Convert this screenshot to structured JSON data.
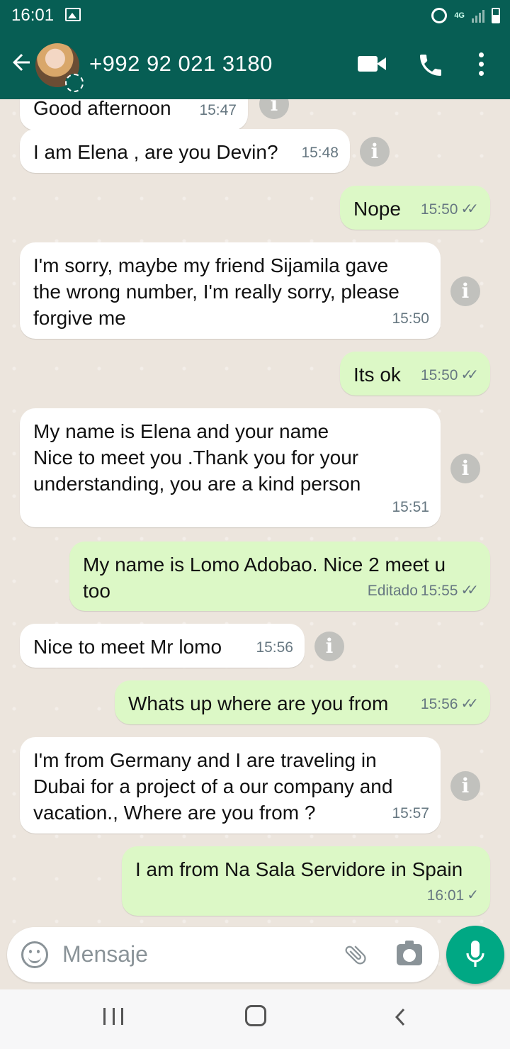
{
  "status_bar": {
    "time": "16:01",
    "network": "4G"
  },
  "header": {
    "contact_name": "+992 92 021 3180"
  },
  "messages": [
    {
      "dir": "in",
      "text": "Good afternoon",
      "time": "15:47",
      "info": true
    },
    {
      "dir": "in",
      "text": "I am Elena , are you Devin?",
      "time": "15:48",
      "info": true
    },
    {
      "dir": "out",
      "text": "Nope",
      "time": "15:50",
      "ticks": "✓✓"
    },
    {
      "dir": "in",
      "text": "I'm sorry, maybe my friend Sijamila gave\nthe wrong number, I'm really sorry, please\nforgive me",
      "time": "15:50",
      "info": true
    },
    {
      "dir": "out",
      "text": "Its ok",
      "time": "15:50",
      "ticks": "✓✓"
    },
    {
      "dir": "in",
      "text": "My name is Elena and your name\nNice to meet you .Thank you for your\nunderstanding, you are a kind person",
      "time": "15:51",
      "info": true
    },
    {
      "dir": "out",
      "text": "My name is Lomo Adobao. Nice 2 meet u\ntoo",
      "time": "15:55",
      "edited": "Editado",
      "ticks": "✓✓"
    },
    {
      "dir": "in",
      "text": "Nice to meet Mr lomo",
      "time": "15:56",
      "info": true
    },
    {
      "dir": "out",
      "text": "Whats up where are you from",
      "time": "15:56",
      "ticks": "✓✓"
    },
    {
      "dir": "in",
      "text": "I'm from Germany and I are traveling in\nDubai for a project of a our company and\nvacation., Where are you from ?",
      "time": "15:57",
      "info": true
    },
    {
      "dir": "out",
      "text": "I am from Na Sala Servidore in Spain",
      "time": "16:01",
      "ticks": "✓"
    }
  ],
  "input": {
    "placeholder": "Mensaje"
  },
  "icons": {
    "back": "arrow-left-icon",
    "video": "video-call-icon",
    "call": "phone-icon",
    "menu": "more-vert-icon",
    "emoji": "emoji-icon",
    "attach": "paperclip-icon",
    "camera": "camera-icon",
    "mic": "microphone-icon",
    "info": "info-icon"
  },
  "colors": {
    "header": "#075e54",
    "outgoing": "#dcf8c6",
    "incoming": "#ffffff",
    "accent": "#00a884",
    "background": "#ece5dd"
  }
}
